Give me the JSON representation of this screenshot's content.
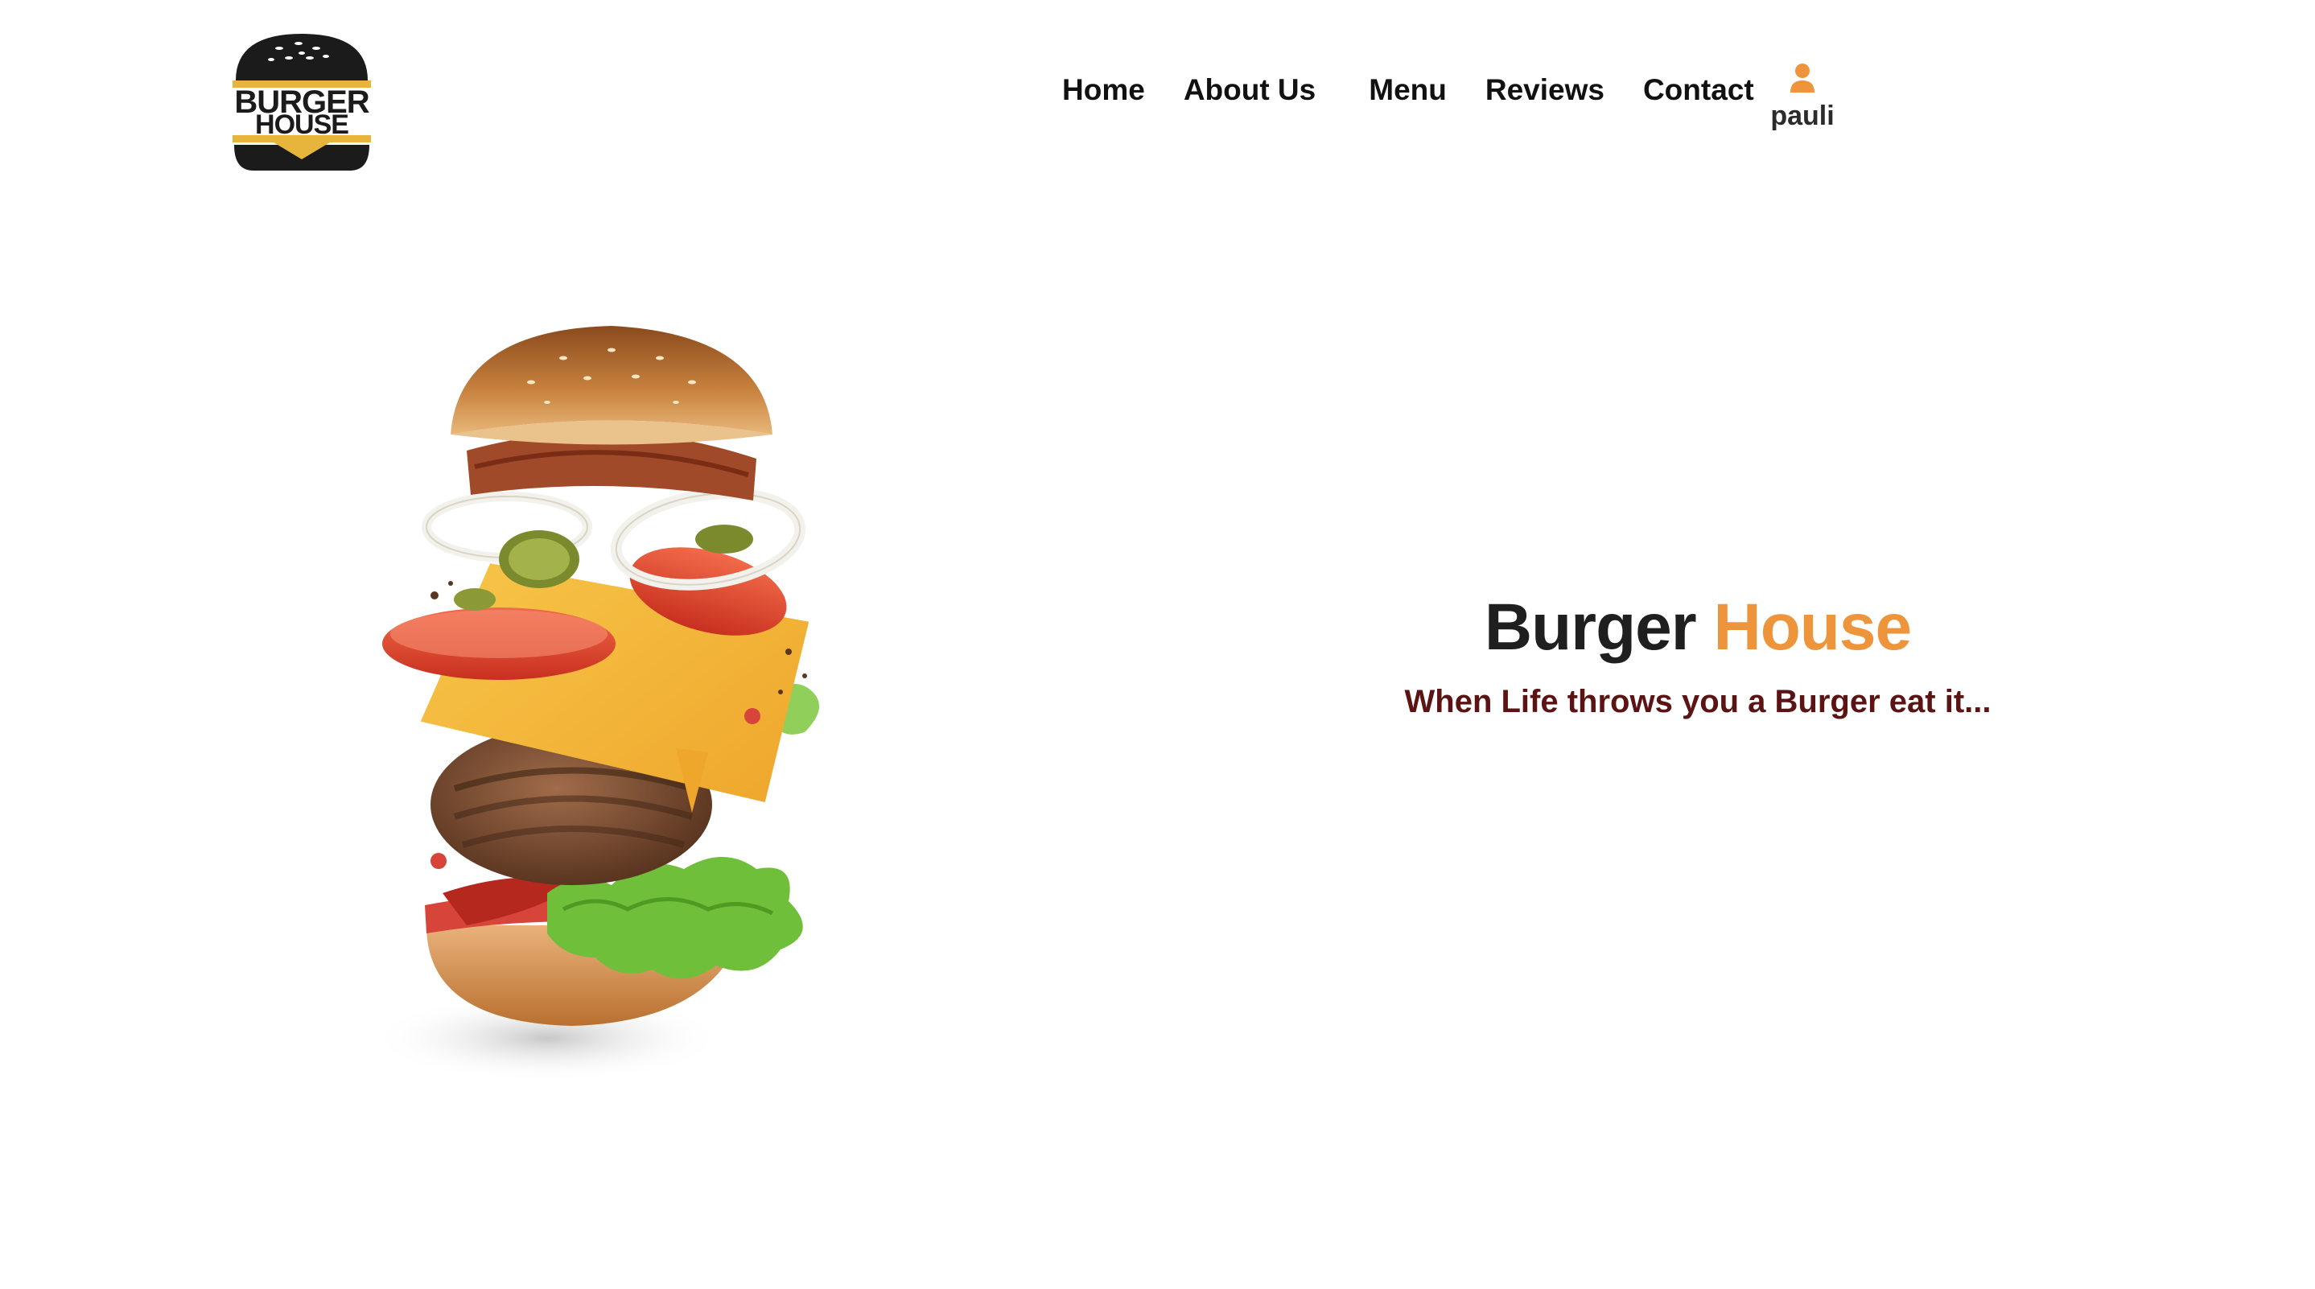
{
  "brand": {
    "logo_line1": "BURGER",
    "logo_line2": "HOUSE",
    "logo_dark": "#1b1b1b",
    "logo_gold": "#e7b53c"
  },
  "nav": {
    "items": [
      {
        "label": "Home"
      },
      {
        "label": "About Us"
      },
      {
        "label": "Menu"
      },
      {
        "label": "Reviews"
      },
      {
        "label": "Contact"
      }
    ]
  },
  "user": {
    "icon": "user-icon",
    "name": "pauli",
    "icon_color": "#ee953c"
  },
  "hero": {
    "title_main": "Burger",
    "title_accent": "House",
    "tagline": "When Life throws you a Burger eat it...",
    "accent_color": "#ee953c",
    "tagline_color": "#5b1313",
    "image": "flying-burger-illustration"
  }
}
